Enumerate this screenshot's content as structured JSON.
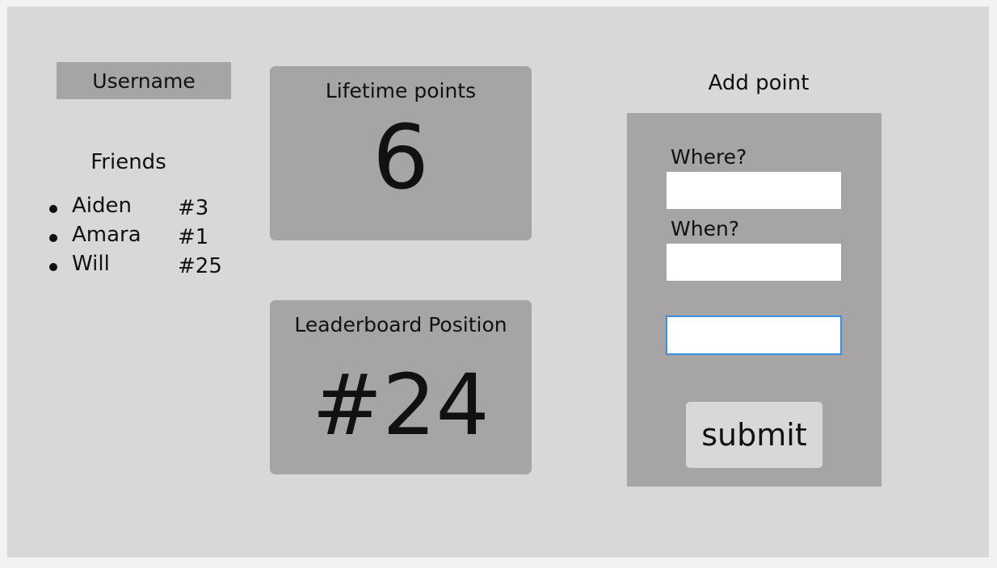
{
  "profile": {
    "username_label": "Username"
  },
  "friends": {
    "title": "Friends",
    "items": [
      {
        "name": "Aiden",
        "rank": "#3"
      },
      {
        "name": "Amara",
        "rank": "#1"
      },
      {
        "name": "Will",
        "rank": "#25"
      }
    ]
  },
  "stats": {
    "lifetime": {
      "title": "Lifetime points",
      "value": "6"
    },
    "leaderboard": {
      "title": "Leaderboard Position",
      "value": "#24"
    }
  },
  "add_point": {
    "title": "Add point",
    "where_label": "Where?",
    "where_value": "",
    "when_label": "When?",
    "when_value": "",
    "third_value": "",
    "submit_label": "submit"
  },
  "colors": {
    "background": "#d8d8d8",
    "panel": "#a6a4a4",
    "focus_border": "#3b8fe0"
  }
}
